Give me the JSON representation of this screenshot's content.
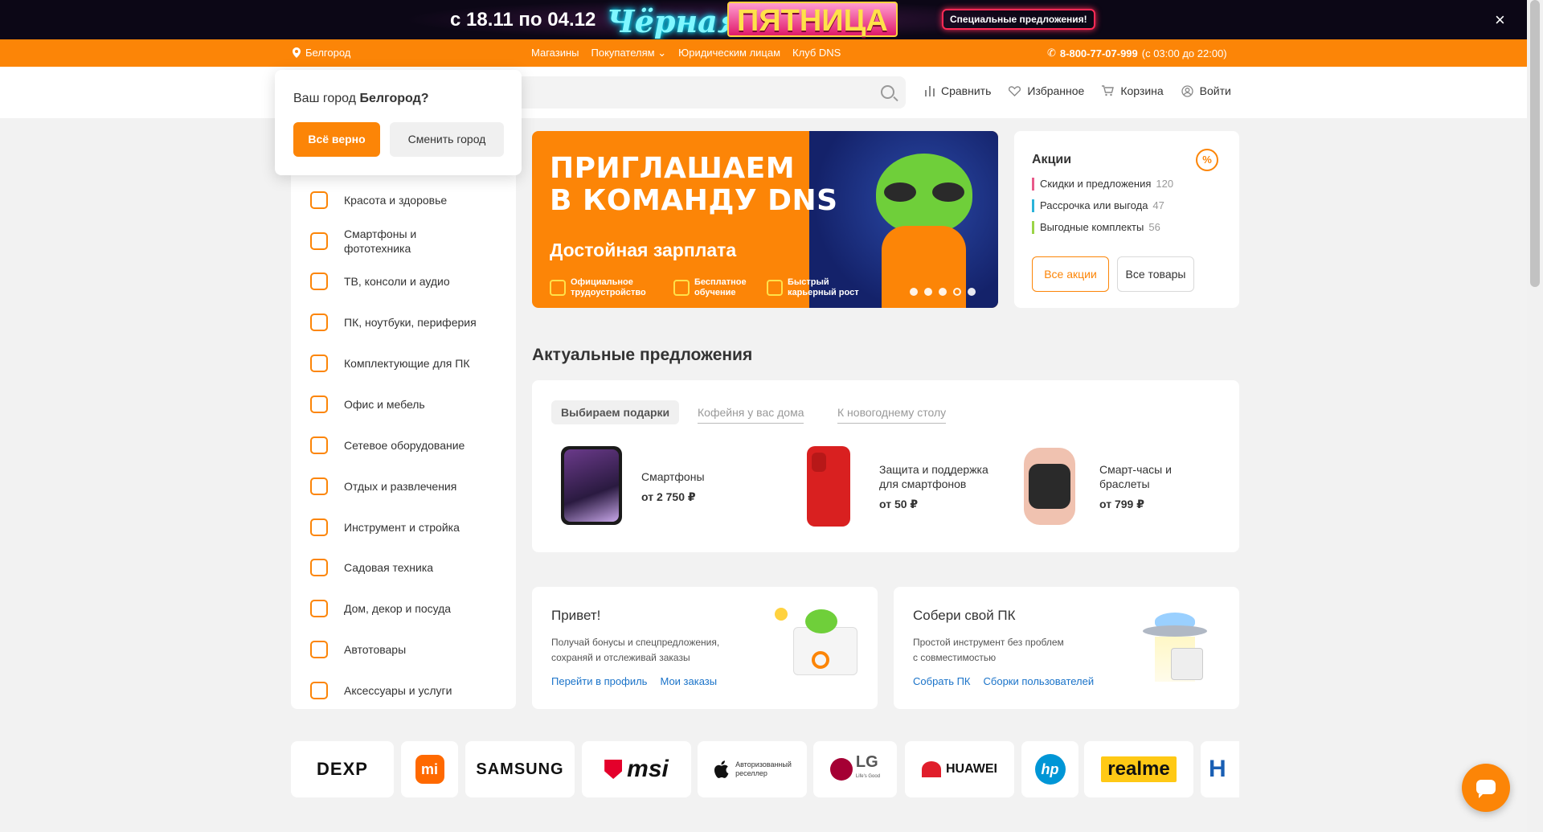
{
  "promo": {
    "dates": "с 18.11 по 04.12",
    "black": "Чёрная",
    "friday": "ПЯТНИЦА",
    "offers_button": "Специальные предложения!",
    "close": "×"
  },
  "topbar": {
    "city": "Белгород",
    "nav": [
      "Магазины",
      "Покупателям",
      "Юридическим лицам",
      "Клуб DNS"
    ],
    "phone": "8-800-77-07-999",
    "hours": "(с 03:00 до 22:00)"
  },
  "header": {
    "links": [
      {
        "label": "Сравнить",
        "icon": "compare-icon"
      },
      {
        "label": "Избранное",
        "icon": "heart-icon"
      },
      {
        "label": "Корзина",
        "icon": "cart-icon"
      },
      {
        "label": "Войти",
        "icon": "user-icon"
      }
    ]
  },
  "city_popup": {
    "question_prefix": "Ваш город ",
    "question_city": "Белгород?",
    "confirm": "Всё верно",
    "change": "Сменить город"
  },
  "catalog": {
    "items": [
      "Красота и здоровье",
      "Смартфоны и фототехника",
      "ТВ, консоли и аудио",
      "ПК, ноутбуки, периферия",
      "Комплектующие для ПК",
      "Офис и мебель",
      "Сетевое оборудование",
      "Отдых и развлечения",
      "Инструмент и стройка",
      "Садовая техника",
      "Дом, декор и посуда",
      "Автотовары",
      "Аксессуары и услуги"
    ]
  },
  "hero": {
    "title_line1": "ПРИГЛАШАЕМ",
    "title_line2": "В КОМАНДУ DNS",
    "subtitle": "Достойная зарплата",
    "features": [
      [
        "Официальное",
        "трудоустройство"
      ],
      [
        "Бесплатное",
        "обучение"
      ],
      [
        "Быстрый",
        "карьерный рост"
      ]
    ],
    "slides": 5,
    "active_slide": 4
  },
  "akcii": {
    "title": "Акции",
    "rows": [
      {
        "label": "Скидки и предложения",
        "count": "120",
        "color": "#e85a8a"
      },
      {
        "label": "Рассрочка или выгода",
        "count": "47",
        "color": "#2bb3d9"
      },
      {
        "label": "Выгодные комплекты",
        "count": "56",
        "color": "#9bd447"
      }
    ],
    "all_promos": "Все акции",
    "all_goods": "Все товары"
  },
  "offers": {
    "title": "Актуальные предложения",
    "tabs": [
      "Выбираем подарки",
      "Кофейня у вас дома",
      "К новогоднему столу"
    ],
    "products": [
      {
        "name_line1": "Смартфоны",
        "name_line2": "",
        "price": "от 2 750 ₽"
      },
      {
        "name_line1": "Защита и поддержка",
        "name_line2": "для смартфонов",
        "price": "от 50 ₽"
      },
      {
        "name_line1": "Смарт-часы и",
        "name_line2": "браслеты",
        "price": "от 799 ₽"
      }
    ]
  },
  "cards": {
    "profile": {
      "title": "Привет!",
      "text_line1": "Получай бонусы и спецпредложения,",
      "text_line2": "сохраняй и отслеживай заказы",
      "link1": "Перейти в профиль",
      "link2": "Мои заказы"
    },
    "pc": {
      "title": "Собери свой ПК",
      "text_line1": "Простой инструмент без проблем",
      "text_line2": "с совместимостью",
      "link1": "Собрать ПК",
      "link2": "Сборки пользователей"
    }
  },
  "brands": {
    "dexp": "DEXP",
    "mi": "mi",
    "samsung": "SAMSUNG",
    "msi": "msi",
    "apple_line1": "Авторизованный",
    "apple_line2": "реселлер",
    "lg": "LG",
    "lg_sub": "Life's Good",
    "huawei": "HUAWEI",
    "hp": "hp",
    "realme": "realme",
    "h": "H"
  },
  "colors": {
    "accent": "#fc8507",
    "link": "#1a73c9"
  }
}
